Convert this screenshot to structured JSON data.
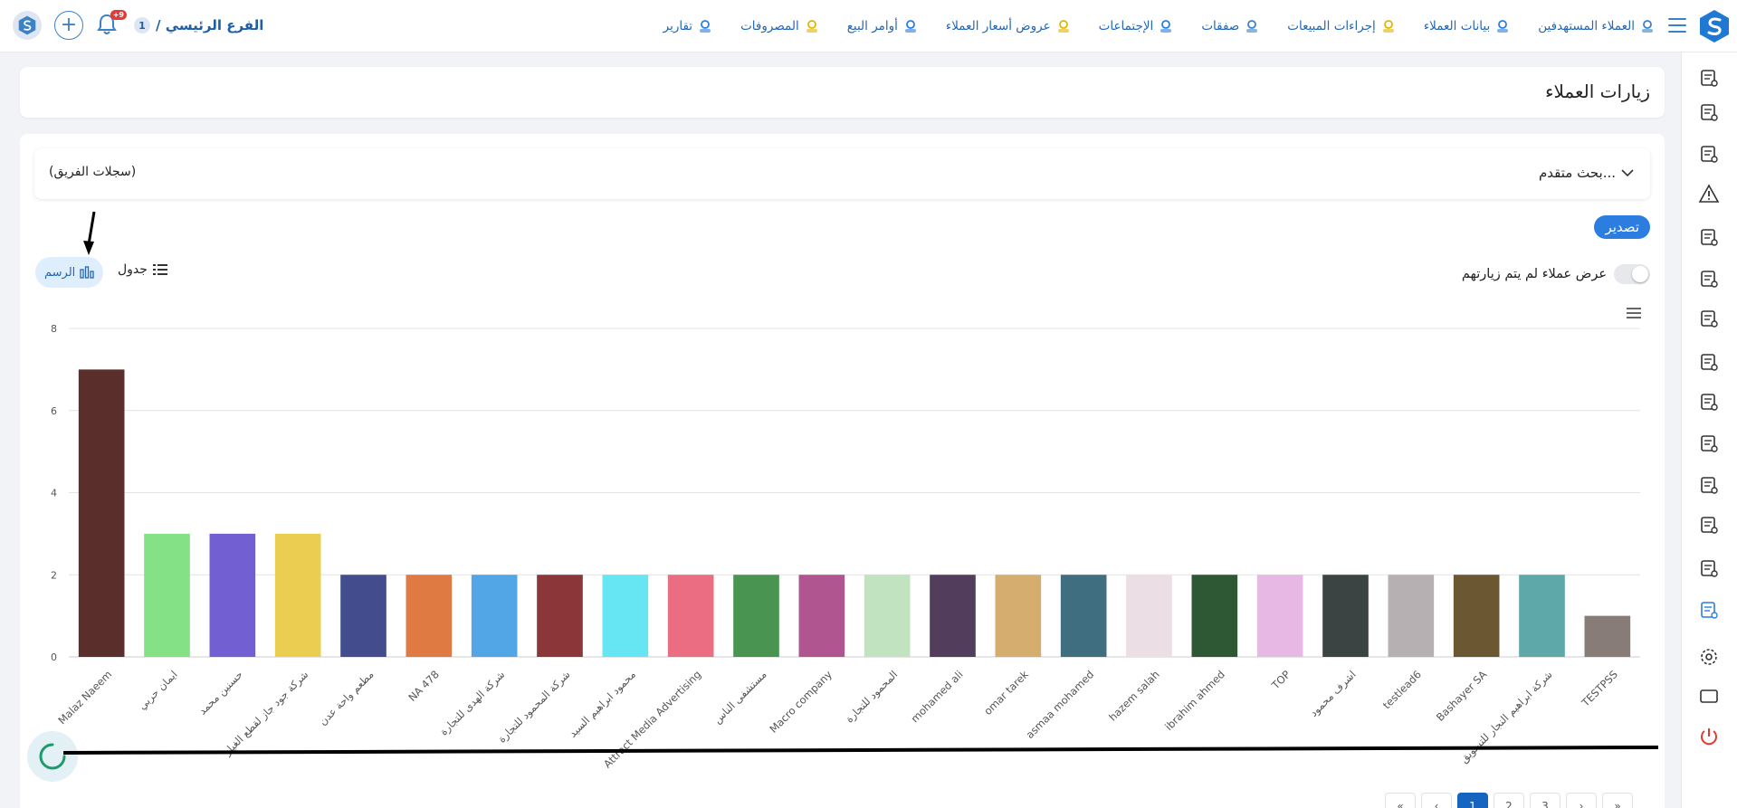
{
  "topbar": {
    "branch_name": "الفرع الرئيسي /",
    "branch_number": "1",
    "notification_count": "+9",
    "nav": [
      {
        "label": "العملاء المستهدفين",
        "icon": "target-customers-icon",
        "color": "#3b82c4"
      },
      {
        "label": "بيانات العملاء",
        "icon": "customer-data-icon",
        "color": "#2b7de0"
      },
      {
        "label": "إجراءات المبيعات",
        "icon": "sales-actions-icon",
        "color": "#e2b400"
      },
      {
        "label": "صفقات",
        "icon": "deals-icon",
        "color": "#3b82c4"
      },
      {
        "label": "الإجتماعات",
        "icon": "meetings-icon",
        "color": "#2b7de0"
      },
      {
        "label": "عروض أسعار العملاء",
        "icon": "quotes-icon",
        "color": "#e2b400"
      },
      {
        "label": "أوامر البيع",
        "icon": "sales-orders-icon",
        "color": "#2b7de0"
      },
      {
        "label": "المصروفات",
        "icon": "expenses-icon",
        "color": "#e2b400"
      },
      {
        "label": "تقارير",
        "icon": "reports-icon",
        "color": "#2b7de0"
      }
    ]
  },
  "sidebar": {
    "icons": [
      "calendar-add-icon",
      "cake-icon",
      "money-icon",
      "warning-icon",
      "video-call-icon",
      "mountain-icon",
      "invoice-icon",
      "pen-icon",
      "printer-icon",
      "truck-box-icon",
      "contact-icon",
      "document-add-icon",
      "report-bag-icon",
      "chart-icon",
      "settings-icon",
      "monitor-icon",
      "power-icon"
    ]
  },
  "page": {
    "title": "زيارات العملاء",
    "advanced_search": "بحث متقدم...",
    "team_records": "(سجلات الفريق)",
    "export_label": "تصدير",
    "toggle_label": "عرض عملاء لم يتم زيارتهم",
    "view_table": "جدول",
    "view_chart": "الرسم"
  },
  "pager": {
    "pages": [
      "«",
      "‹",
      "1",
      "2",
      "3",
      "›",
      "»"
    ],
    "active": "1",
    "info": "..."
  },
  "chart_data": {
    "type": "bar",
    "ylim": [
      0,
      8
    ],
    "yticks": [
      0,
      2,
      4,
      6,
      8
    ],
    "grid": true,
    "categories": [
      "Malaz Naeem",
      "ايمان حربي",
      "حسنين محمد",
      "شركة جود جاز لقطع الغيار",
      "مطعم واحة عدن",
      "NA 478",
      "شركة الهدى للتجارة",
      "شركة المحمود للتجارة",
      "محمود ابراهيم السيد",
      "Attract Media Advertising",
      "مستشفى الناس",
      "Macro company",
      "المحمود للتجارة",
      "mohamed ali",
      "omar tarek",
      "asmaa mohamed",
      "hazem salah",
      "ibrahim ahmed",
      "TOP",
      "اشرف محمود",
      "testlead6",
      "Bashayer SA",
      "شركة ابراهيم النجار للتسويق",
      "TESTPSS"
    ],
    "values": [
      7,
      3,
      3,
      3,
      2,
      2,
      2,
      2,
      2,
      2,
      2,
      2,
      2,
      2,
      2,
      2,
      2,
      2,
      2,
      2,
      2,
      2,
      2,
      1
    ],
    "colors": [
      "#5a2e2b",
      "#85e186",
      "#7260d2",
      "#ebce51",
      "#434d8e",
      "#df7a43",
      "#52a6e6",
      "#8b3638",
      "#66e5f2",
      "#ea6d82",
      "#4a9451",
      "#b15590",
      "#c2e3bf",
      "#533d5c",
      "#d5ad6f",
      "#3e6e80",
      "#ebdfe5",
      "#2e5734",
      "#e8b8e5",
      "#3b4443",
      "#b6b0b3",
      "#6b5732",
      "#5ea8aa",
      "#877c78"
    ]
  }
}
